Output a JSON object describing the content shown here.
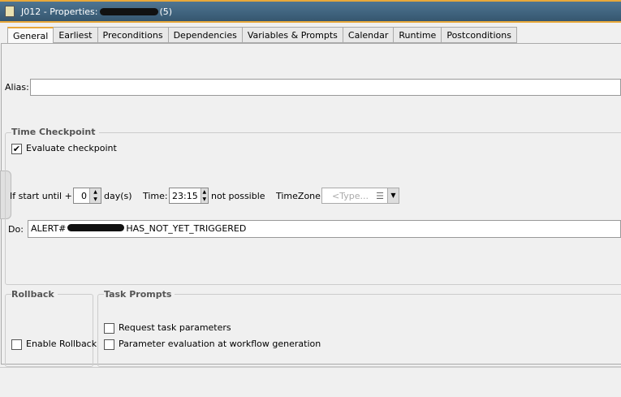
{
  "window": {
    "title_prefix": "J012 - Properties:",
    "title_suffix": "(5)"
  },
  "tabs": [
    "General",
    "Earliest",
    "Preconditions",
    "Dependencies",
    "Variables & Prompts",
    "Calendar",
    "Runtime",
    "Postconditions"
  ],
  "alias": {
    "label": "Alias:",
    "value": ""
  },
  "time_checkpoint": {
    "title": "Time Checkpoint",
    "evaluate_label": "Evaluate checkpoint",
    "evaluate_checked": true,
    "if_start_label": "If start until +:",
    "days_value": "0",
    "days_unit": "day(s)",
    "time_label": "Time:",
    "time_value": "23:15",
    "not_possible": "not possible",
    "timezone_label": "TimeZone:",
    "timezone_placeholder": "<Type...",
    "do_label": "Do:",
    "do_value_prefix": "ALERT#",
    "do_value_suffix": "HAS_NOT_YET_TRIGGERED"
  },
  "rollback": {
    "title": "Rollback",
    "enable_label": "Enable Rollback",
    "enabled": false
  },
  "task_prompts": {
    "title": "Task Prompts",
    "request_label": "Request task parameters",
    "param_eval_label": "Parameter evaluation at workflow generation"
  }
}
